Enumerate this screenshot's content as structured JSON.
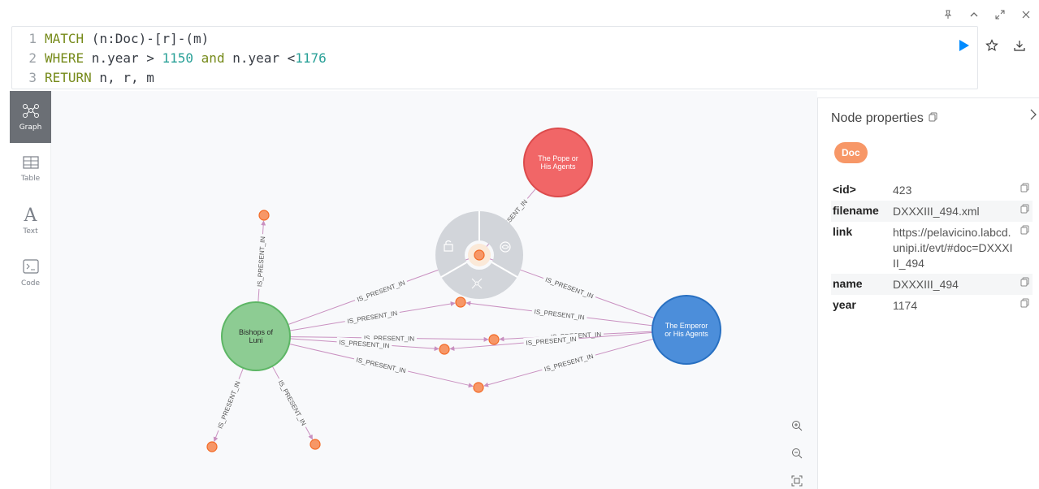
{
  "window_controls": [
    "pin",
    "collapse",
    "expand",
    "close"
  ],
  "editor": {
    "lines": [
      {
        "no": "1",
        "tokens": [
          [
            "kw",
            "MATCH"
          ],
          [
            "txt",
            " (n:Doc)-[r]-(m)"
          ]
        ]
      },
      {
        "no": "2",
        "tokens": [
          [
            "kw",
            "WHERE"
          ],
          [
            "txt",
            " n.year > "
          ],
          [
            "num",
            "1150"
          ],
          [
            "txt",
            " "
          ],
          [
            "kw",
            "and"
          ],
          [
            "txt",
            " n.year <"
          ],
          [
            "num",
            "1176"
          ]
        ]
      },
      {
        "no": "3",
        "tokens": [
          [
            "kw",
            "RETURN"
          ],
          [
            "txt",
            " n, r, m"
          ]
        ]
      }
    ],
    "actions": [
      "run-icon",
      "star-icon",
      "download-icon"
    ]
  },
  "sidebar": {
    "items": [
      {
        "label": "Graph",
        "icon": "graph-icon",
        "active": true
      },
      {
        "label": "Table",
        "icon": "table-icon",
        "active": false
      },
      {
        "label": "Text",
        "icon": "text-icon",
        "active": false
      },
      {
        "label": "Code",
        "icon": "code-icon",
        "active": false
      }
    ]
  },
  "graph": {
    "big_nodes": [
      {
        "id": "pope",
        "label": "The Pope or His Agents",
        "color": "#f16667",
        "stroke": "#dc4b4c"
      },
      {
        "id": "bishops",
        "label": "Bishops of Luni",
        "color": "#8dcc93",
        "stroke": "#5db665"
      },
      {
        "id": "emperor",
        "label": "The Emperor or His Agents",
        "color": "#4c8eda",
        "stroke": "#2870c2"
      }
    ],
    "doc_color": "#f79767",
    "doc_stroke": "#f36924",
    "rel_label": "IS_PRESENT_IN",
    "rel_color": "#c990c0",
    "selected_ring_color": "#d2d5da"
  },
  "zoom": [
    "zoom-in-icon",
    "zoom-out-icon",
    "fit-icon"
  ],
  "properties": {
    "title": "Node properties",
    "label": "Doc",
    "rows": [
      {
        "key": "<id>",
        "value": "423"
      },
      {
        "key": "filename",
        "value": "DXXXIII_494.xml"
      },
      {
        "key": "link",
        "value": "https://pelavicino.labcd.unipi.it/evt/#doc=DXXXIII_494"
      },
      {
        "key": "name",
        "value": "DXXXIII_494"
      },
      {
        "key": "year",
        "value": "1174"
      }
    ]
  }
}
